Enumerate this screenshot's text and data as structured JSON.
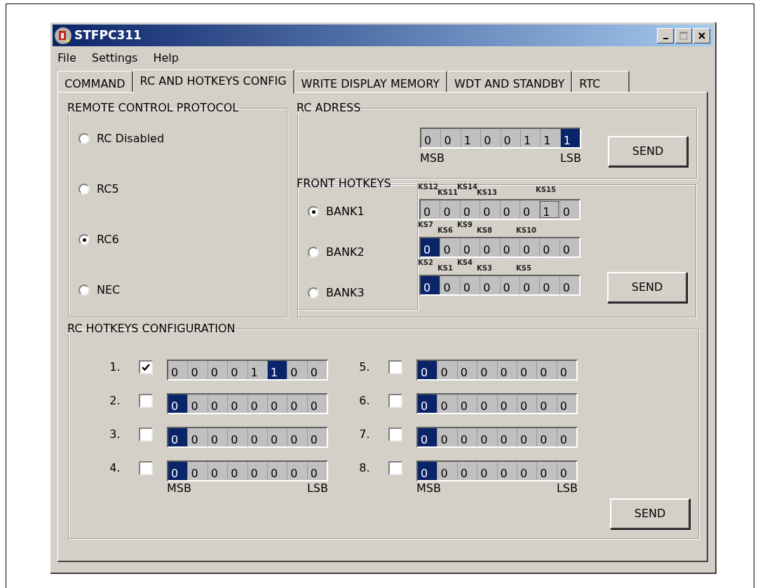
{
  "window": {
    "title": "STFPC311"
  },
  "menu": [
    "File",
    "Settings",
    "Help"
  ],
  "tabs": [
    {
      "label": "COMMAND",
      "selected": false
    },
    {
      "label": "RC AND HOTKEYS CONFIG",
      "selected": true
    },
    {
      "label": "WRITE DISPLAY MEMORY",
      "selected": false
    },
    {
      "label": "WDT AND STANDBY",
      "selected": false
    },
    {
      "label": "RTC",
      "selected": false
    }
  ],
  "protocol_group": {
    "title": "REMOTE CONTROL PROTOCOL",
    "options": [
      {
        "label": "RC Disabled",
        "selected": false
      },
      {
        "label": "RC5",
        "selected": false
      },
      {
        "label": "RC6",
        "selected": true
      },
      {
        "label": "NEC",
        "selected": false
      }
    ]
  },
  "rc_address": {
    "title": "RC ADRESS",
    "msb_label": "MSB",
    "lsb_label": "LSB",
    "send": "SEND",
    "bits": [
      {
        "value": "0",
        "selected": false
      },
      {
        "value": "0",
        "selected": false
      },
      {
        "value": "1",
        "selected": false
      },
      {
        "value": "0",
        "selected": false
      },
      {
        "value": "0",
        "selected": false
      },
      {
        "value": "1",
        "selected": false
      },
      {
        "value": "1",
        "selected": false
      },
      {
        "value": "1",
        "selected": true
      }
    ]
  },
  "front_hotkeys": {
    "title": "FRONT HOTKEYS",
    "send": "SEND",
    "banks": [
      {
        "label": "BANK1",
        "selected": true
      },
      {
        "label": "BANK2",
        "selected": false
      },
      {
        "label": "BANK3",
        "selected": false
      }
    ],
    "rows": [
      {
        "bits": [
          {
            "value": "0",
            "selected": false,
            "focused": false,
            "key": "KS12"
          },
          {
            "value": "0",
            "selected": false,
            "focused": false,
            "key": "KS11"
          },
          {
            "value": "0",
            "selected": false,
            "focused": false,
            "key": "KS14"
          },
          {
            "value": "0",
            "selected": false,
            "focused": false,
            "key": "KS13"
          },
          {
            "value": "0",
            "selected": false,
            "focused": false
          },
          {
            "value": "0",
            "selected": false,
            "focused": false
          },
          {
            "value": "1",
            "selected": false,
            "focused": true,
            "key": "KS15"
          },
          {
            "value": "0",
            "selected": false,
            "focused": false
          }
        ]
      },
      {
        "bits": [
          {
            "value": "0",
            "selected": true,
            "focused": false,
            "key": "KS7"
          },
          {
            "value": "0",
            "selected": false,
            "focused": false,
            "key": "KS6"
          },
          {
            "value": "0",
            "selected": false,
            "focused": false,
            "key": "KS9"
          },
          {
            "value": "0",
            "selected": false,
            "focused": false,
            "key": "KS8"
          },
          {
            "value": "0",
            "selected": false,
            "focused": false
          },
          {
            "value": "0",
            "selected": false,
            "focused": false,
            "key": "KS10"
          },
          {
            "value": "0",
            "selected": false,
            "focused": false
          },
          {
            "value": "0",
            "selected": false,
            "focused": false
          }
        ]
      },
      {
        "bits": [
          {
            "value": "0",
            "selected": true,
            "focused": false,
            "key": "KS2"
          },
          {
            "value": "0",
            "selected": false,
            "focused": false,
            "key": "KS1"
          },
          {
            "value": "0",
            "selected": false,
            "focused": false,
            "key": "KS4"
          },
          {
            "value": "0",
            "selected": false,
            "focused": false,
            "key": "KS3"
          },
          {
            "value": "0",
            "selected": false,
            "focused": false
          },
          {
            "value": "0",
            "selected": false,
            "focused": false,
            "key": "KS5"
          },
          {
            "value": "0",
            "selected": false,
            "focused": false
          },
          {
            "value": "0",
            "selected": false,
            "focused": false
          }
        ]
      }
    ]
  },
  "rc_hotkeys": {
    "title": "RC HOTKEYS CONFIGURATION",
    "send": "SEND",
    "columns": [
      {
        "msb_label": "MSB",
        "lsb_label": "LSB",
        "entries": [
          {
            "number": "1.",
            "checked": true,
            "bits": [
              {
                "value": "0",
                "selected": false
              },
              {
                "value": "0",
                "selected": false
              },
              {
                "value": "0",
                "selected": false
              },
              {
                "value": "0",
                "selected": false
              },
              {
                "value": "1",
                "selected": false
              },
              {
                "value": "1",
                "selected": true
              },
              {
                "value": "0",
                "selected": false
              },
              {
                "value": "0",
                "selected": false
              }
            ]
          },
          {
            "number": "2.",
            "checked": false,
            "bits": [
              {
                "value": "0",
                "selected": true
              },
              {
                "value": "0",
                "selected": false
              },
              {
                "value": "0",
                "selected": false
              },
              {
                "value": "0",
                "selected": false
              },
              {
                "value": "0",
                "selected": false
              },
              {
                "value": "0",
                "selected": false
              },
              {
                "value": "0",
                "selected": false
              },
              {
                "value": "0",
                "selected": false
              }
            ]
          },
          {
            "number": "3.",
            "checked": false,
            "bits": [
              {
                "value": "0",
                "selected": true
              },
              {
                "value": "0",
                "selected": false
              },
              {
                "value": "0",
                "selected": false
              },
              {
                "value": "0",
                "selected": false
              },
              {
                "value": "0",
                "selected": false
              },
              {
                "value": "0",
                "selected": false
              },
              {
                "value": "0",
                "selected": false
              },
              {
                "value": "0",
                "selected": false
              }
            ]
          },
          {
            "number": "4.",
            "checked": false,
            "bits": [
              {
                "value": "0",
                "selected": true
              },
              {
                "value": "0",
                "selected": false
              },
              {
                "value": "0",
                "selected": false
              },
              {
                "value": "0",
                "selected": false
              },
              {
                "value": "0",
                "selected": false
              },
              {
                "value": "0",
                "selected": false
              },
              {
                "value": "0",
                "selected": false
              },
              {
                "value": "0",
                "selected": false
              }
            ]
          }
        ]
      },
      {
        "msb_label": "MSB",
        "lsb_label": "LSB",
        "entries": [
          {
            "number": "5.",
            "checked": false,
            "bits": [
              {
                "value": "0",
                "selected": true
              },
              {
                "value": "0",
                "selected": false
              },
              {
                "value": "0",
                "selected": false
              },
              {
                "value": "0",
                "selected": false
              },
              {
                "value": "0",
                "selected": false
              },
              {
                "value": "0",
                "selected": false
              },
              {
                "value": "0",
                "selected": false
              },
              {
                "value": "0",
                "selected": false
              }
            ]
          },
          {
            "number": "6.",
            "checked": false,
            "bits": [
              {
                "value": "0",
                "selected": true
              },
              {
                "value": "0",
                "selected": false
              },
              {
                "value": "0",
                "selected": false
              },
              {
                "value": "0",
                "selected": false
              },
              {
                "value": "0",
                "selected": false
              },
              {
                "value": "0",
                "selected": false
              },
              {
                "value": "0",
                "selected": false
              },
              {
                "value": "0",
                "selected": false
              }
            ]
          },
          {
            "number": "7.",
            "checked": false,
            "bits": [
              {
                "value": "0",
                "selected": true
              },
              {
                "value": "0",
                "selected": false
              },
              {
                "value": "0",
                "selected": false
              },
              {
                "value": "0",
                "selected": false
              },
              {
                "value": "0",
                "selected": false
              },
              {
                "value": "0",
                "selected": false
              },
              {
                "value": "0",
                "selected": false
              },
              {
                "value": "0",
                "selected": false
              }
            ]
          },
          {
            "number": "8.",
            "checked": false,
            "bits": [
              {
                "value": "0",
                "selected": true
              },
              {
                "value": "0",
                "selected": false
              },
              {
                "value": "0",
                "selected": false
              },
              {
                "value": "0",
                "selected": false
              },
              {
                "value": "0",
                "selected": false
              },
              {
                "value": "0",
                "selected": false
              },
              {
                "value": "0",
                "selected": false
              },
              {
                "value": "0",
                "selected": false
              }
            ]
          }
        ]
      }
    ]
  }
}
